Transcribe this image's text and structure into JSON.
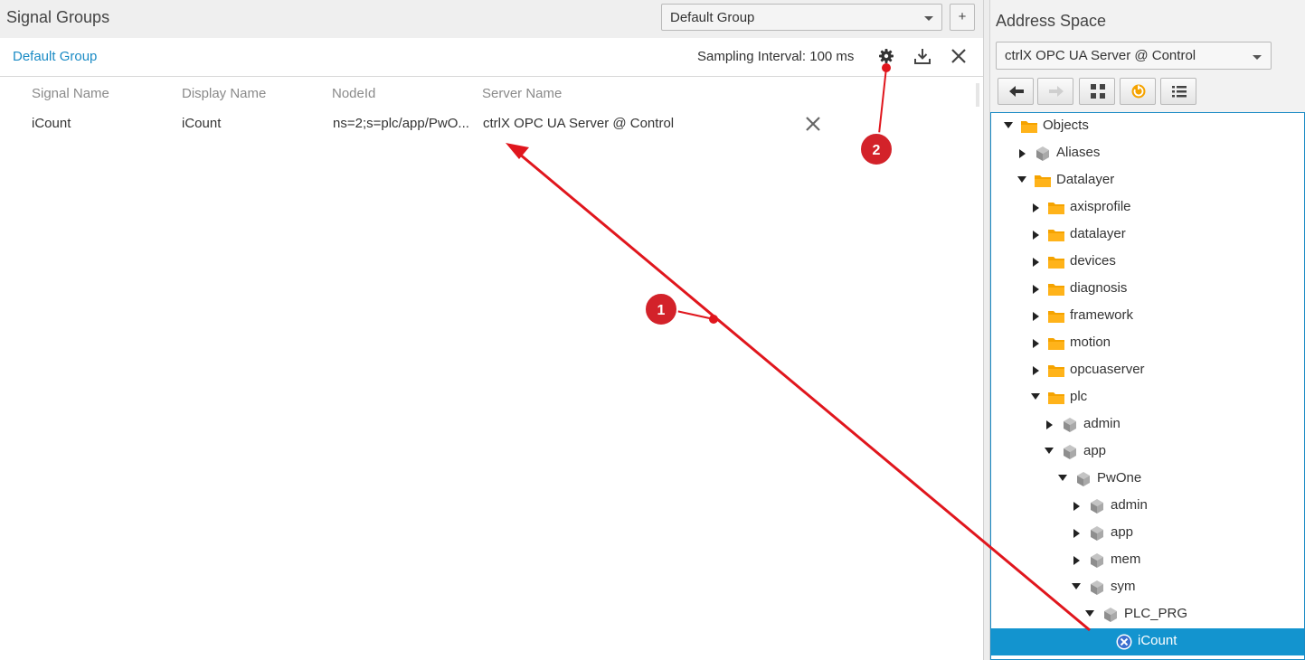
{
  "signal_groups": {
    "title": "Signal Groups",
    "group_select": "Default Group",
    "add_label": "+",
    "active_group": "Default Group",
    "sampling": "Sampling Interval: 100 ms",
    "columns": [
      "Signal Name",
      "Display Name",
      "NodeId",
      "Server Name"
    ],
    "rows": [
      {
        "signal": "iCount",
        "display": "iCount",
        "nodeid": "ns=2;s=plc/app/PwO...",
        "server": "ctrlX OPC UA Server @ Control"
      }
    ]
  },
  "address_space": {
    "title": "Address Space",
    "server_select": "ctrlX OPC UA Server @ Control",
    "toolbar": [
      "back-icon",
      "forward-icon",
      "expand-icon",
      "refresh-icon",
      "list-icon"
    ],
    "tree": [
      {
        "label": "Objects",
        "icon": "folder",
        "expanded": true
      },
      {
        "label": "Aliases",
        "icon": "cube",
        "expanded": false
      },
      {
        "label": "Datalayer",
        "icon": "folder",
        "expanded": true
      },
      {
        "label": "axisprofile",
        "icon": "folder",
        "expanded": false
      },
      {
        "label": "datalayer",
        "icon": "folder",
        "expanded": false
      },
      {
        "label": "devices",
        "icon": "folder",
        "expanded": false
      },
      {
        "label": "diagnosis",
        "icon": "folder",
        "expanded": false
      },
      {
        "label": "framework",
        "icon": "folder",
        "expanded": false
      },
      {
        "label": "motion",
        "icon": "folder",
        "expanded": false
      },
      {
        "label": "opcuaserver",
        "icon": "folder",
        "expanded": false
      },
      {
        "label": "plc",
        "icon": "folder",
        "expanded": true
      },
      {
        "label": "admin",
        "icon": "cube",
        "expanded": false
      },
      {
        "label": "app",
        "icon": "cube",
        "expanded": true
      },
      {
        "label": "PwOne",
        "icon": "cube",
        "expanded": true
      },
      {
        "label": "admin",
        "icon": "cube",
        "expanded": false
      },
      {
        "label": "app",
        "icon": "cube",
        "expanded": false
      },
      {
        "label": "mem",
        "icon": "cube",
        "expanded": false
      },
      {
        "label": "sym",
        "icon": "cube",
        "expanded": true
      },
      {
        "label": "PLC_PRG",
        "icon": "cube",
        "expanded": true
      },
      {
        "label": "iCount",
        "icon": "variable",
        "selected": true
      }
    ]
  },
  "annotations": {
    "badge1": "1",
    "badge2": "2",
    "color": "#e0161d"
  },
  "colors": {
    "accent": "#1b8bc5",
    "selection": "#1394cf",
    "folder": "#f5a300"
  }
}
